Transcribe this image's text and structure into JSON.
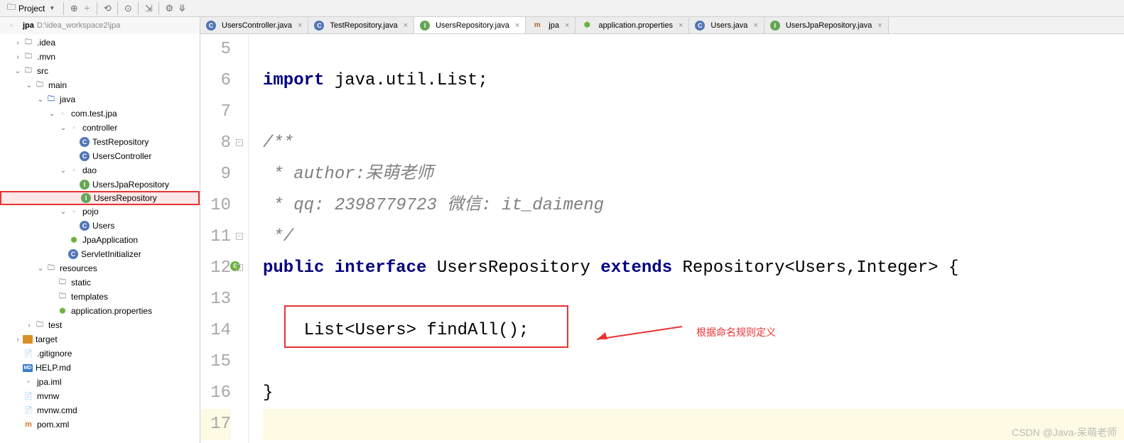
{
  "toolbar": {
    "label": "Project"
  },
  "breadcrumb": {
    "root": "jpa",
    "path": "D:\\idea_workspace2\\jpa"
  },
  "tree": {
    "idea": ".idea",
    "mvn": ".mvn",
    "src": "src",
    "main": "main",
    "java": "java",
    "pkg": "com.test.jpa",
    "controller": "controller",
    "testRepo": "TestRepository",
    "usersController": "UsersController",
    "dao": "dao",
    "usersJpaRepo": "UsersJpaRepository",
    "usersRepo": "UsersRepository",
    "pojo": "pojo",
    "users": "Users",
    "jpaApp": "JpaApplication",
    "servletInit": "ServletInitializer",
    "resources": "resources",
    "static": "static",
    "templates": "templates",
    "appProps": "application.properties",
    "test": "test",
    "target": "target",
    "gitignore": ".gitignore",
    "help": "HELP.md",
    "jpaIml": "jpa.iml",
    "mvnw": "mvnw",
    "mvnwCmd": "mvnw.cmd",
    "pom": "pom.xml"
  },
  "tabs": {
    "t1": "UsersController.java",
    "t2": "TestRepository.java",
    "t3": "UsersRepository.java",
    "t4": "jpa",
    "t5": "application.properties",
    "t6": "Users.java",
    "t7": "UsersJpaRepository.java"
  },
  "code": {
    "l6a": "import",
    "l6b": " java.util.List;",
    "l8": "/**",
    "l9": " * author:呆萌老师",
    "l10": " * qq: 2398779723 微信: it_daimeng",
    "l11": " */",
    "l12a": "public",
    "l12b": " interface",
    "l12c": " UsersRepository ",
    "l12d": "extends",
    "l12e": " Repository<Users,Integer> {",
    "l14": "    List<Users> findAll();",
    "l16": "}"
  },
  "lineNumbers": [
    "5",
    "6",
    "7",
    "8",
    "9",
    "10",
    "11",
    "12",
    "13",
    "14",
    "15",
    "16",
    "17"
  ],
  "annotation": {
    "text": "根据命名规则定义"
  },
  "watermark": "CSDN @Java-呆萌老师"
}
